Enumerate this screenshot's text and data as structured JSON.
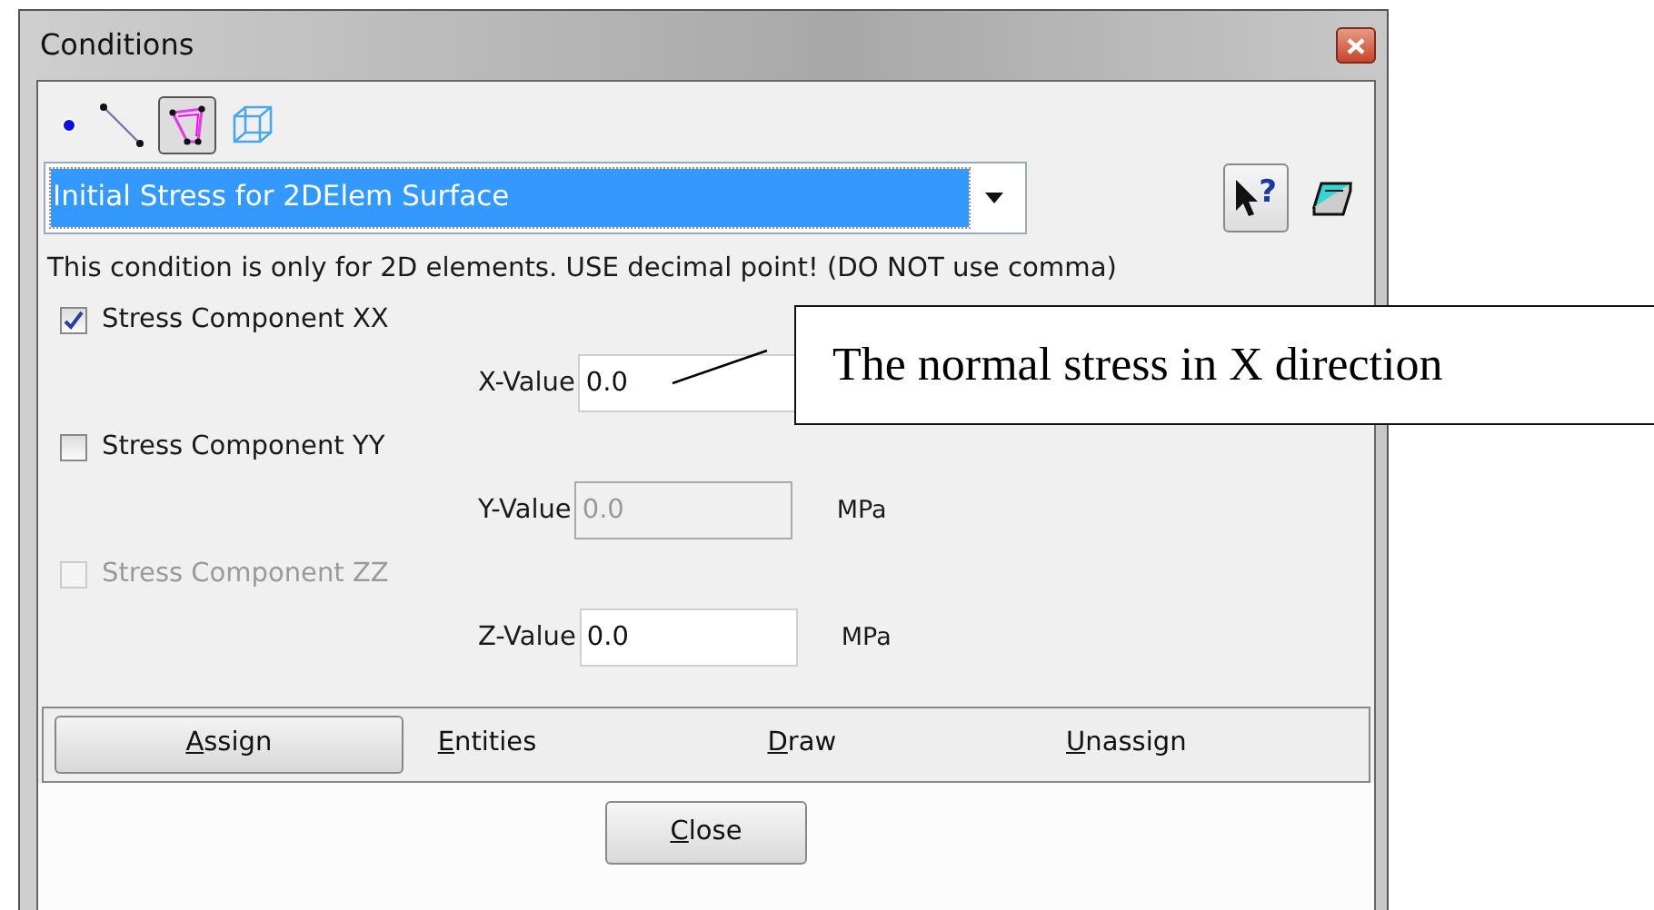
{
  "window": {
    "title": "Conditions"
  },
  "entity_types": [
    {
      "kind": "point",
      "selected": false
    },
    {
      "kind": "line",
      "selected": false
    },
    {
      "kind": "surface",
      "selected": true
    },
    {
      "kind": "volume",
      "selected": false
    }
  ],
  "condition": {
    "value": "Initial Stress for 2DElem Surface"
  },
  "help_button": {
    "label": "?"
  },
  "note": "This condition is only for 2D elements. USE decimal point! (DO NOT use comma)",
  "components": [
    {
      "label": "Stress Component XX",
      "checked": true,
      "disabled": false,
      "field_label": "X-Value",
      "value": "0.0",
      "field_disabled": false
    },
    {
      "label": "Stress Component YY",
      "checked": false,
      "disabled": false,
      "field_label": "Y-Value",
      "value": "0.0",
      "field_disabled": true,
      "unit": "MPa"
    },
    {
      "label": "Stress Component ZZ",
      "checked": false,
      "disabled": true,
      "field_label": "Z-Value",
      "value": "0.0",
      "field_disabled": false,
      "unit": "MPa"
    }
  ],
  "actions": [
    {
      "label": "Assign",
      "selected": true,
      "mnemonic": true
    },
    {
      "label": "Entities",
      "selected": false,
      "mnemonic": true
    },
    {
      "label": "Draw",
      "selected": false,
      "mnemonic": true
    },
    {
      "label": "Unassign",
      "selected": false,
      "mnemonic": true
    }
  ],
  "close_button": {
    "label": "Close",
    "mnemonic": true
  },
  "callout": {
    "text": "The normal stress in X direction"
  }
}
